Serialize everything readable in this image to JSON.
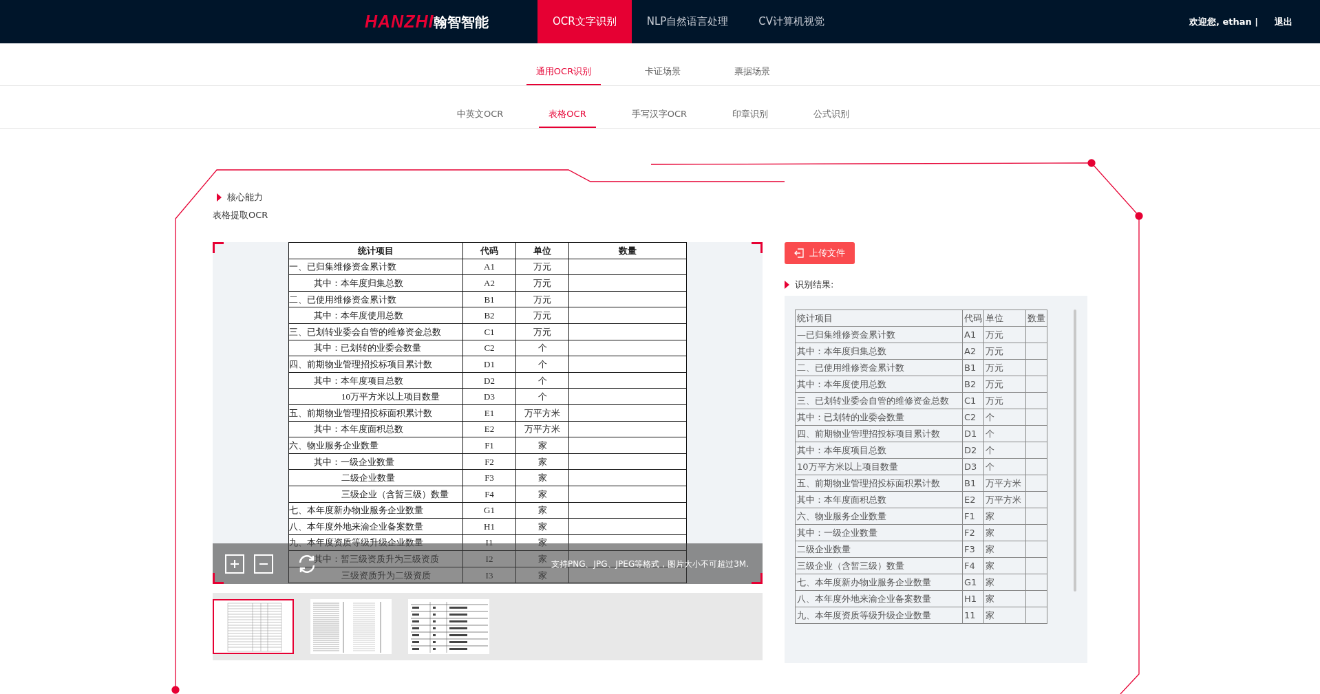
{
  "brand": {
    "wordmark": "HANZHI",
    "name": "翰智智能"
  },
  "nav": [
    {
      "label": "OCR文字识别",
      "selected": true
    },
    {
      "label": "NLP自然语言处理",
      "selected": false
    },
    {
      "label": "CV计算机视觉",
      "selected": false
    }
  ],
  "user": {
    "greeting": "欢迎您, ethan |",
    "logout": "退出"
  },
  "scene_tabs": [
    {
      "label": "通用OCR识别",
      "selected": true
    },
    {
      "label": "卡证场景",
      "selected": false
    },
    {
      "label": "票据场景",
      "selected": false
    }
  ],
  "type_tabs": [
    {
      "label": "中英文OCR",
      "selected": false
    },
    {
      "label": "表格OCR",
      "selected": true
    },
    {
      "label": "手写汉字OCR",
      "selected": false
    },
    {
      "label": "印章识别",
      "selected": false
    },
    {
      "label": "公式识别",
      "selected": false
    }
  ],
  "section": {
    "title": "核心能力",
    "subtitle": "表格提取OCR"
  },
  "document": {
    "columns": [
      "统计项目",
      "代码",
      "单位",
      "数量"
    ],
    "rows": [
      {
        "kind": "top",
        "cells": [
          "一、已归集维修资金累计数",
          "A1",
          "万元"
        ]
      },
      {
        "kind": "sub",
        "cells": [
          "其中：本年度归集总数",
          "A2",
          "万元"
        ]
      },
      {
        "kind": "top",
        "cells": [
          "二、已使用维修资金累计数",
          "B1",
          "万元"
        ]
      },
      {
        "kind": "sub",
        "cells": [
          "其中：本年度使用总数",
          "B2",
          "万元"
        ]
      },
      {
        "kind": "top",
        "cells": [
          "三、已划转业委会自管的维修资金总数",
          "C1",
          "万元"
        ]
      },
      {
        "kind": "sub",
        "cells": [
          "其中：已划转的业委会数量",
          "C2",
          "个"
        ]
      },
      {
        "kind": "top",
        "cells": [
          "四、前期物业管理招投标项目累计数",
          "D1",
          "个"
        ]
      },
      {
        "kind": "sub",
        "cells": [
          "其中：本年度项目总数",
          "D2",
          "个"
        ]
      },
      {
        "kind": "subsub",
        "cells": [
          "10万平方米以上项目数量",
          "D3",
          "个"
        ]
      },
      {
        "kind": "top",
        "cells": [
          "五、前期物业管理招投标面积累计数",
          "E1",
          "万平方米"
        ]
      },
      {
        "kind": "sub",
        "cells": [
          "其中：本年度面积总数",
          "E2",
          "万平方米"
        ]
      },
      {
        "kind": "top",
        "cells": [
          "六、物业服务企业数量",
          "F1",
          "家"
        ]
      },
      {
        "kind": "sub",
        "cells": [
          "其中：一级企业数量",
          "F2",
          "家"
        ]
      },
      {
        "kind": "subsub",
        "cells": [
          "二级企业数量",
          "F3",
          "家"
        ]
      },
      {
        "kind": "subsub",
        "cells": [
          "三级企业（含暂三级）数量",
          "F4",
          "家"
        ]
      },
      {
        "kind": "top",
        "cells": [
          "七、本年度新办物业服务企业数量",
          "G1",
          "家"
        ]
      },
      {
        "kind": "top",
        "cells": [
          "八、本年度外地来渝企业备案数量",
          "H1",
          "家"
        ]
      },
      {
        "kind": "top",
        "cells": [
          "九、本年度资质等级升级企业数量",
          "I1",
          "家"
        ]
      },
      {
        "kind": "sub",
        "cells": [
          "其中：暂三级资质升为三级资质",
          "I2",
          "家"
        ]
      },
      {
        "kind": "subsub",
        "cells": [
          "三级资质升为二级资质",
          "I3",
          "家"
        ]
      }
    ]
  },
  "preview_hint": "支持PNG、JPG、JPEG等格式，图片大小不可超过3M.",
  "thumbnails": [
    {
      "kind": "table",
      "selected": true
    },
    {
      "kind": "form",
      "selected": false
    },
    {
      "kind": "list",
      "selected": false
    }
  ],
  "upload_button": "上传文件",
  "result": {
    "title": "识别结果:",
    "columns": [
      "统计项目",
      "代码",
      "单位",
      "数量"
    ],
    "rows": [
      [
        "—已归集维修资金累计数",
        "A1",
        "万元"
      ],
      [
        "其中：本年度归集总数",
        "A2",
        "万元"
      ],
      [
        "二、已使用维修资金累计数",
        "B1",
        "万元"
      ],
      [
        "其中：本年度使用总数",
        "B2",
        "万元"
      ],
      [
        "三、已划转业委会自管的维修资金总数",
        "C1",
        "万元"
      ],
      [
        "其中：已划转的业委会数量",
        "C2",
        "个"
      ],
      [
        "四、前期物业管理招投标项目累计数",
        "D1",
        "个"
      ],
      [
        "其中：本年度项目总数",
        "D2",
        "个"
      ],
      [
        "10万平方米以上项目数量",
        "D3",
        "个"
      ],
      [
        "五、前期物业管理招投标面积累计数",
        "B1",
        "万平方米"
      ],
      [
        "其中：本年度面积总数",
        "E2",
        "万平方米"
      ],
      [
        "六、物业服务企业数量",
        "F1",
        "家"
      ],
      [
        "其中：一级企业数量",
        "F2",
        "家"
      ],
      [
        "二级企业数量",
        "F3",
        "家"
      ],
      [
        "三级企业（含暂三级）数量",
        "F4",
        "家"
      ],
      [
        "七、本年度新办物业服务企业数量",
        "G1",
        "家"
      ],
      [
        "八、本年度外地来渝企业备案数量",
        "H1",
        "家"
      ],
      [
        "九、本年度资质等级升级企业数量",
        "11",
        "家"
      ]
    ]
  }
}
